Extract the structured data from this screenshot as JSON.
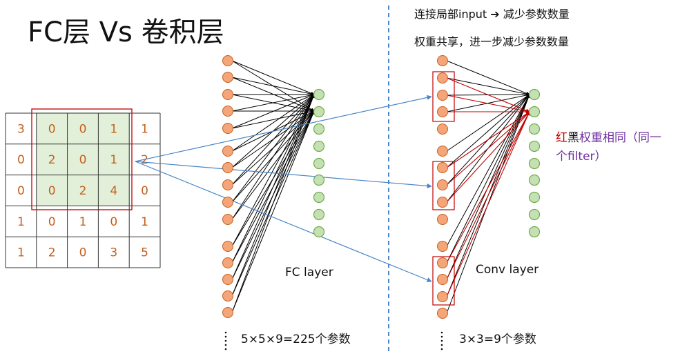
{
  "title": "FC层 Vs 卷积层",
  "notes": {
    "line1_pre": "连接局部input",
    "line1_post": "减少参数数量",
    "line2": "权重共享，进一步减少参数数量"
  },
  "matrix": [
    [
      "3",
      "0",
      "0",
      "1",
      "1"
    ],
    [
      "0",
      "2",
      "0",
      "1",
      "2"
    ],
    [
      "0",
      "0",
      "2",
      "4",
      "0"
    ],
    [
      "1",
      "0",
      "1",
      "0",
      "1"
    ],
    [
      "1",
      "2",
      "0",
      "3",
      "5"
    ]
  ],
  "fc": {
    "caption": "FC layer",
    "params": "5×5×9=225个参数"
  },
  "conv": {
    "caption": "Conv layer",
    "params": "3×3=9个参数"
  },
  "legend": {
    "red": "红",
    "black": "黑",
    "purple_line1": "权重相同（同一",
    "purple_line2": "个filter）"
  },
  "colors": {
    "orange_node": "#f4a57a",
    "orange_stroke": "#c5601c",
    "green_node": "#c5e0b4",
    "green_stroke": "#70ad47",
    "highlight_fill": "#e2efd9",
    "red": "#c00000",
    "blue_arrow": "#4a86c8",
    "divider": "#4a86c8"
  },
  "icons": {
    "arrow": "right-arrow-icon",
    "ellipsis": "vertical-ellipsis-icon"
  }
}
